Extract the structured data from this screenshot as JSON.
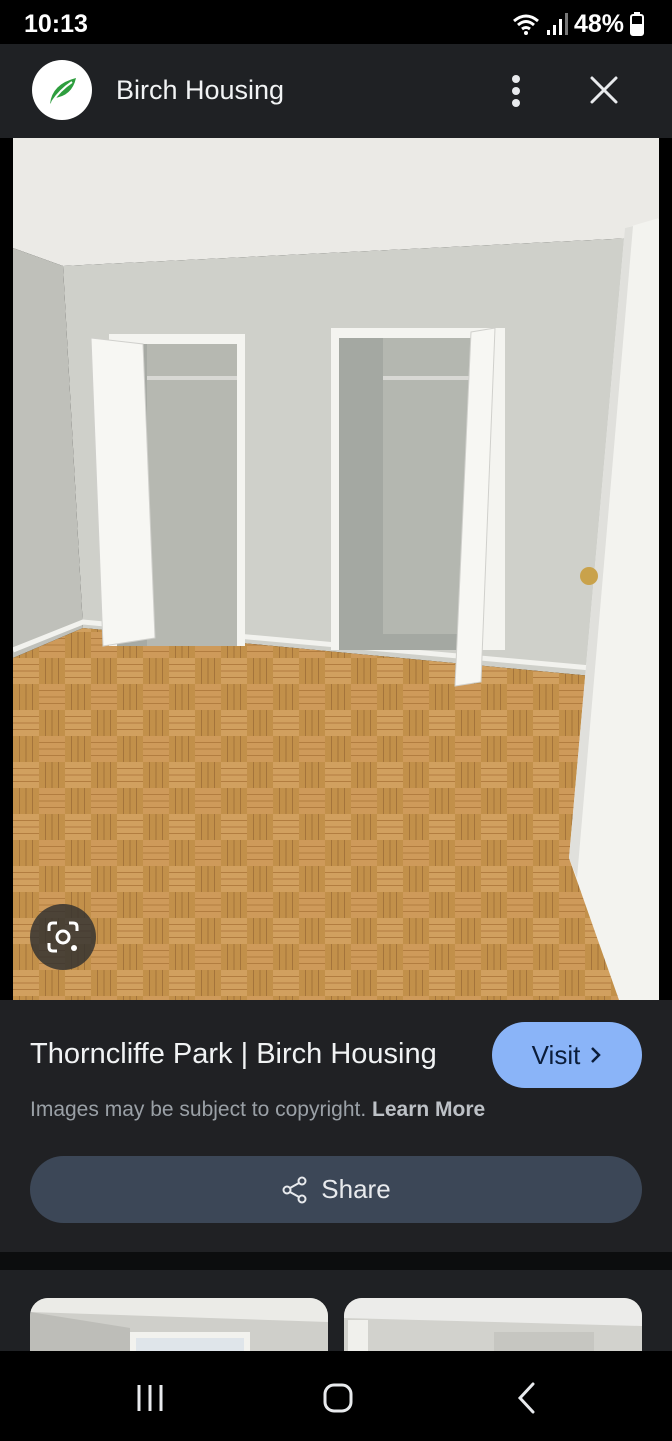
{
  "status_bar": {
    "time": "10:13",
    "battery": "48%",
    "icons": [
      "wifi-icon",
      "signal-icon",
      "battery-icon"
    ]
  },
  "header": {
    "title": "Birch Housing",
    "logo_icon": "leaf-logo-icon",
    "menu_icon": "more-vert-icon",
    "close_icon": "close-icon"
  },
  "result": {
    "title": "Thorncliffe Park | Birch Housing",
    "visit_label": "Visit",
    "copyright": "Images may be subject to copyright.",
    "learn_more": "Learn More",
    "share_label": "Share"
  },
  "navigation": {
    "recents_icon": "recents-icon",
    "home_icon": "home-icon",
    "back_icon": "back-icon"
  },
  "colors": {
    "accent": "#8ab4f8",
    "panel": "#202124",
    "share_button": "#3c4757",
    "logo_green": "#2e9e3e"
  }
}
